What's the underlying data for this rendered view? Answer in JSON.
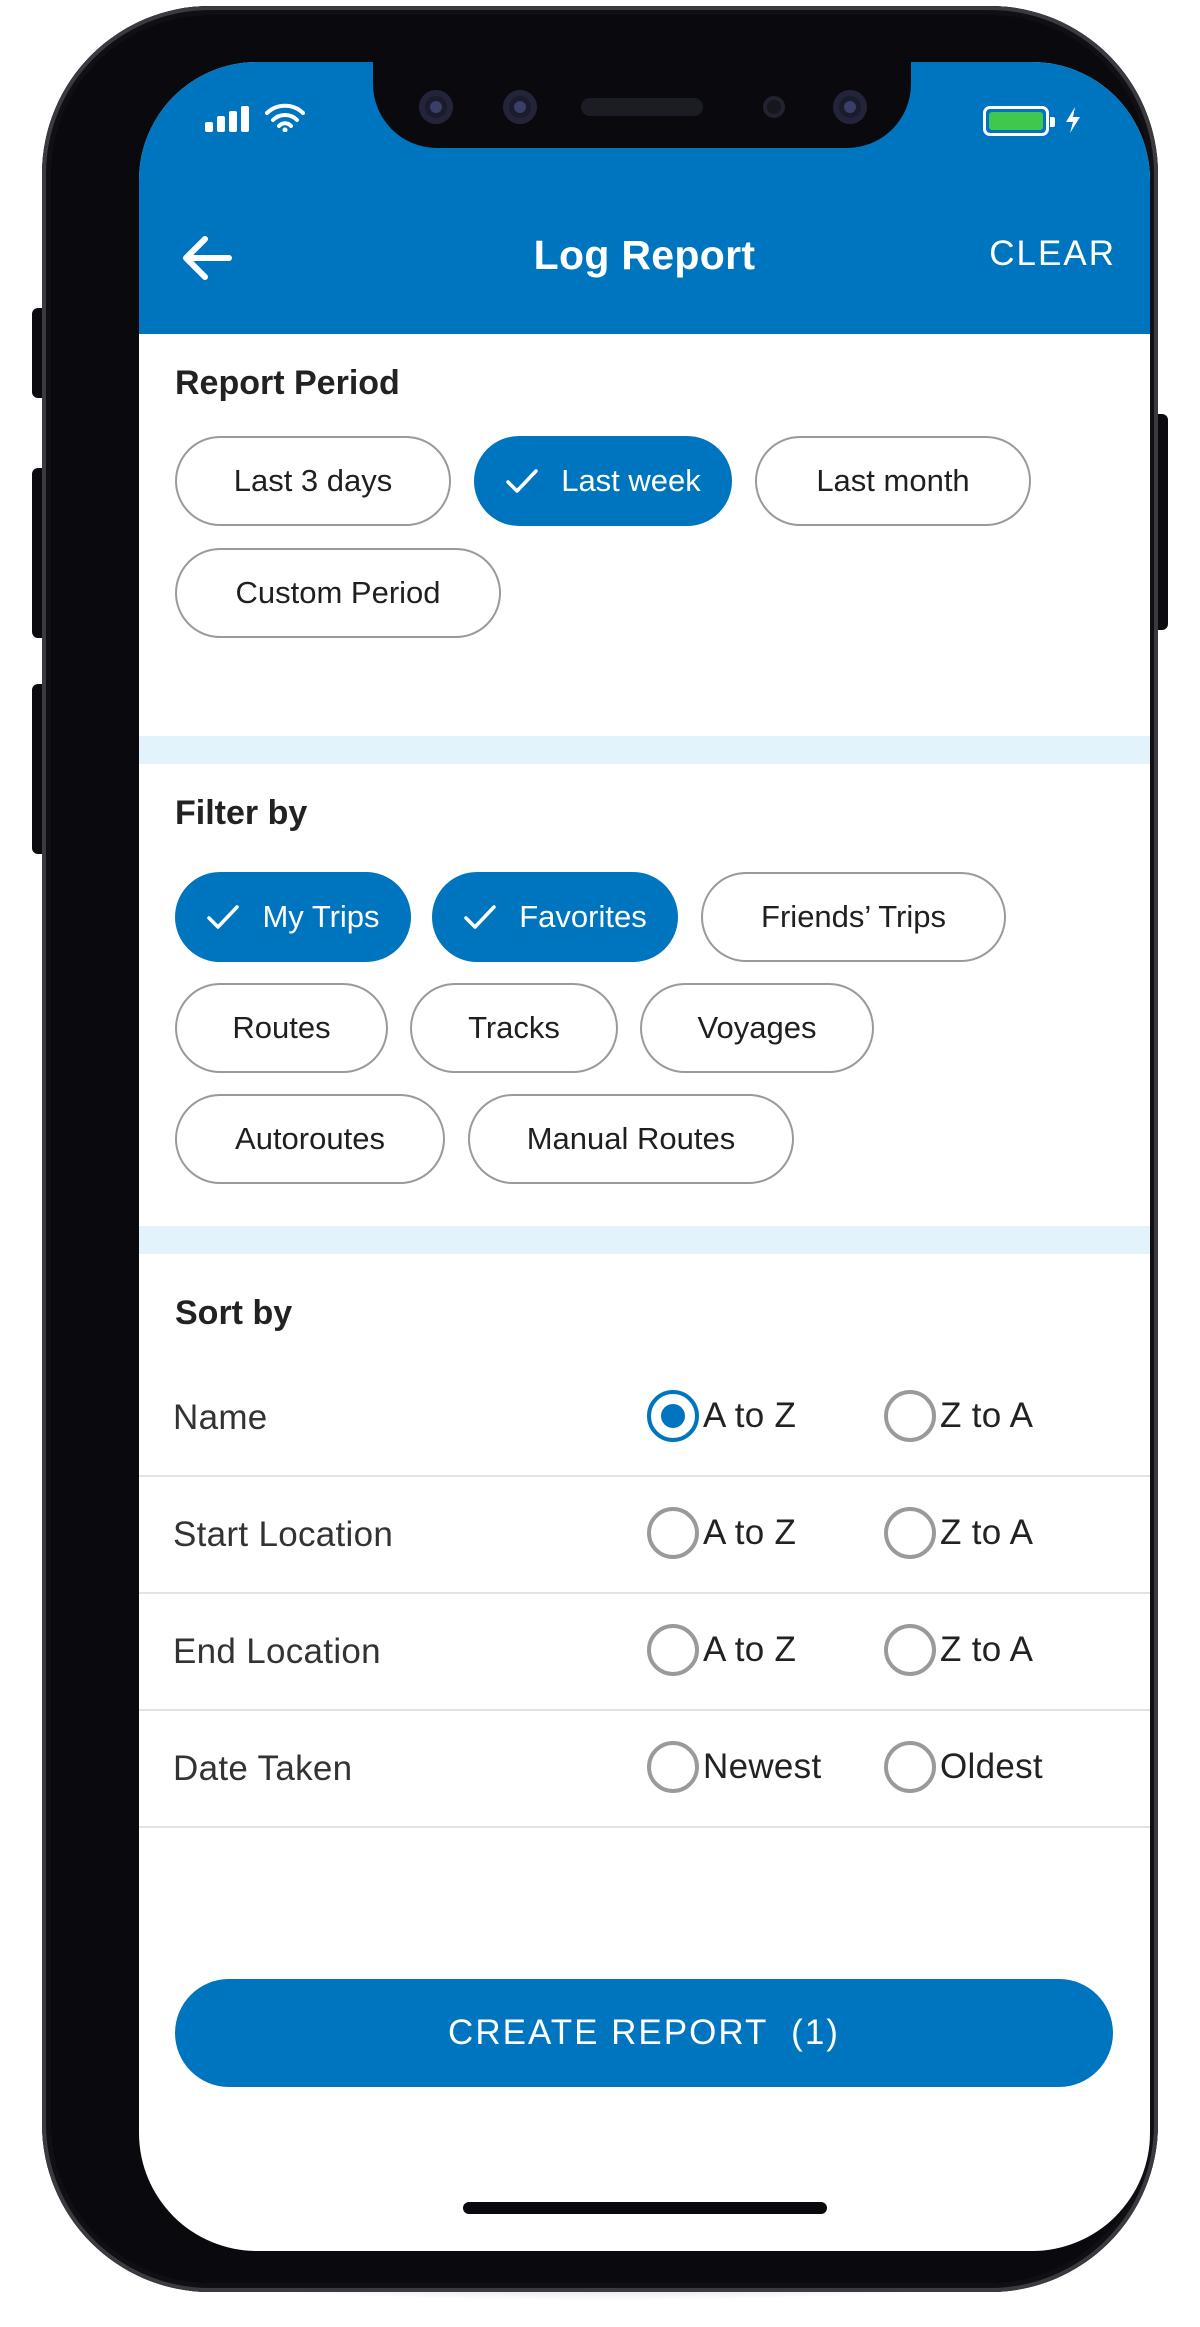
{
  "header": {
    "title": "Log Report",
    "clear_label": "CLEAR"
  },
  "report_period": {
    "title": "Report Period",
    "options": [
      {
        "label": "Last 3 days",
        "selected": false
      },
      {
        "label": "Last week",
        "selected": true
      },
      {
        "label": "Last month",
        "selected": false
      },
      {
        "label": "Custom Period",
        "selected": false
      }
    ]
  },
  "filter": {
    "title": "Filter by",
    "options": [
      {
        "label": "My Trips",
        "selected": true
      },
      {
        "label": "Favorites",
        "selected": true
      },
      {
        "label": "Friends’ Trips",
        "selected": false
      },
      {
        "label": "Routes",
        "selected": false
      },
      {
        "label": "Tracks",
        "selected": false
      },
      {
        "label": "Voyages",
        "selected": false
      },
      {
        "label": "Autoroutes",
        "selected": false
      },
      {
        "label": "Manual Routes",
        "selected": false
      }
    ]
  },
  "sort": {
    "title": "Sort by",
    "rows": [
      {
        "label": "Name",
        "options": [
          "A to Z",
          "Z to A"
        ],
        "selected": 0
      },
      {
        "label": "Start Location",
        "options": [
          "A to Z",
          "Z to A"
        ],
        "selected": null
      },
      {
        "label": "End Location",
        "options": [
          "A to Z",
          "Z to A"
        ],
        "selected": null
      },
      {
        "label": "Date Taken",
        "options": [
          "Newest",
          "Oldest"
        ],
        "selected": null
      }
    ]
  },
  "cta": {
    "label": "CREATE REPORT  (1)"
  },
  "colors": {
    "primary": "#0075bf",
    "section_divider": "#e3f3fc",
    "battery": "#3ec94e",
    "chip_border": "#9a9a9a"
  },
  "icons": [
    "signal-icon",
    "wifi-icon",
    "battery-icon",
    "charging-icon",
    "back-arrow-icon",
    "check-icon"
  ]
}
